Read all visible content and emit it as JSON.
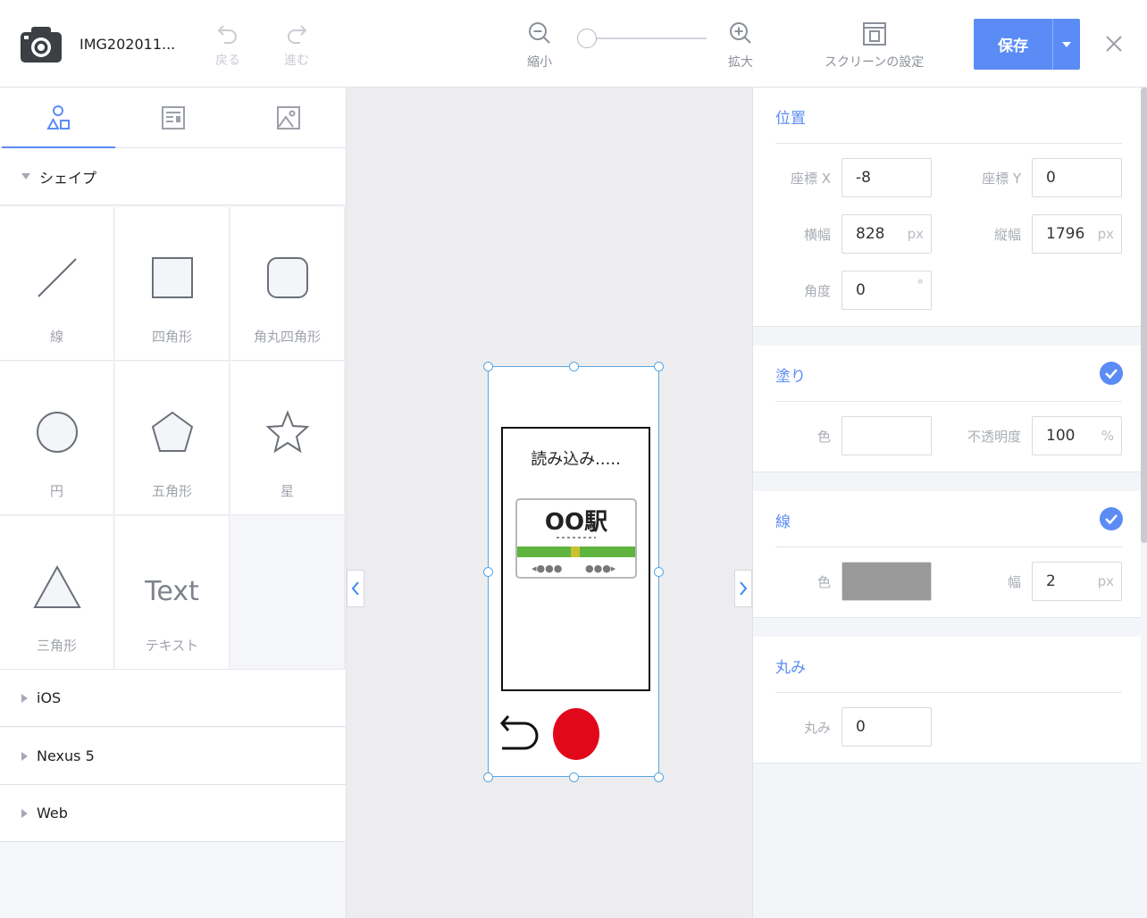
{
  "header": {
    "doc_title": "IMG202011...",
    "undo_label": "戻る",
    "redo_label": "進む",
    "zoom_out_label": "縮小",
    "zoom_in_label": "拡大",
    "zoom_fraction": 0.0,
    "screen_settings_label": "スクリーンの設定",
    "save_label": "保存",
    "accent_color": "#5b8cf5"
  },
  "left_panel": {
    "tabs": [
      {
        "icon": "shapes-icon",
        "active": true
      },
      {
        "icon": "layout-icon",
        "active": false
      },
      {
        "icon": "image-icon",
        "active": false
      }
    ],
    "shapes_section": "シェイプ",
    "shapes": [
      {
        "label": "線",
        "icon": "line-icon"
      },
      {
        "label": "四角形",
        "icon": "rectangle-icon"
      },
      {
        "label": "角丸四角形",
        "icon": "rounded-rectangle-icon"
      },
      {
        "label": "円",
        "icon": "circle-icon"
      },
      {
        "label": "五角形",
        "icon": "pentagon-icon"
      },
      {
        "label": "星",
        "icon": "star-icon"
      },
      {
        "label": "三角形",
        "icon": "triangle-icon"
      },
      {
        "label": "テキスト",
        "glyph": "Text"
      }
    ],
    "collapsed_sections": [
      "iOS",
      "Nexus 5",
      "Web"
    ]
  },
  "canvas": {
    "loading_text": "読み込み.....",
    "station_sign": "OO駅",
    "record_color": "#e2081c"
  },
  "properties": {
    "position": {
      "title": "位置",
      "x_label": "座標 X",
      "x": "-8",
      "y_label": "座標 Y",
      "y": "0",
      "w_label": "横幅",
      "w": "828",
      "w_unit": "px",
      "h_label": "縦幅",
      "h": "1796",
      "h_unit": "px",
      "angle_label": "角度",
      "angle": "0",
      "angle_unit": "°"
    },
    "fill": {
      "title": "塗り",
      "enabled": true,
      "color_label": "色",
      "color": "#ffffff",
      "opacity_label": "不透明度",
      "opacity": "100",
      "opacity_unit": "%"
    },
    "stroke": {
      "title": "線",
      "enabled": true,
      "color_label": "色",
      "color": "#999999",
      "width_label": "幅",
      "width": "2",
      "width_unit": "px"
    },
    "radius": {
      "title": "丸み",
      "label": "丸み",
      "value": "0"
    }
  }
}
